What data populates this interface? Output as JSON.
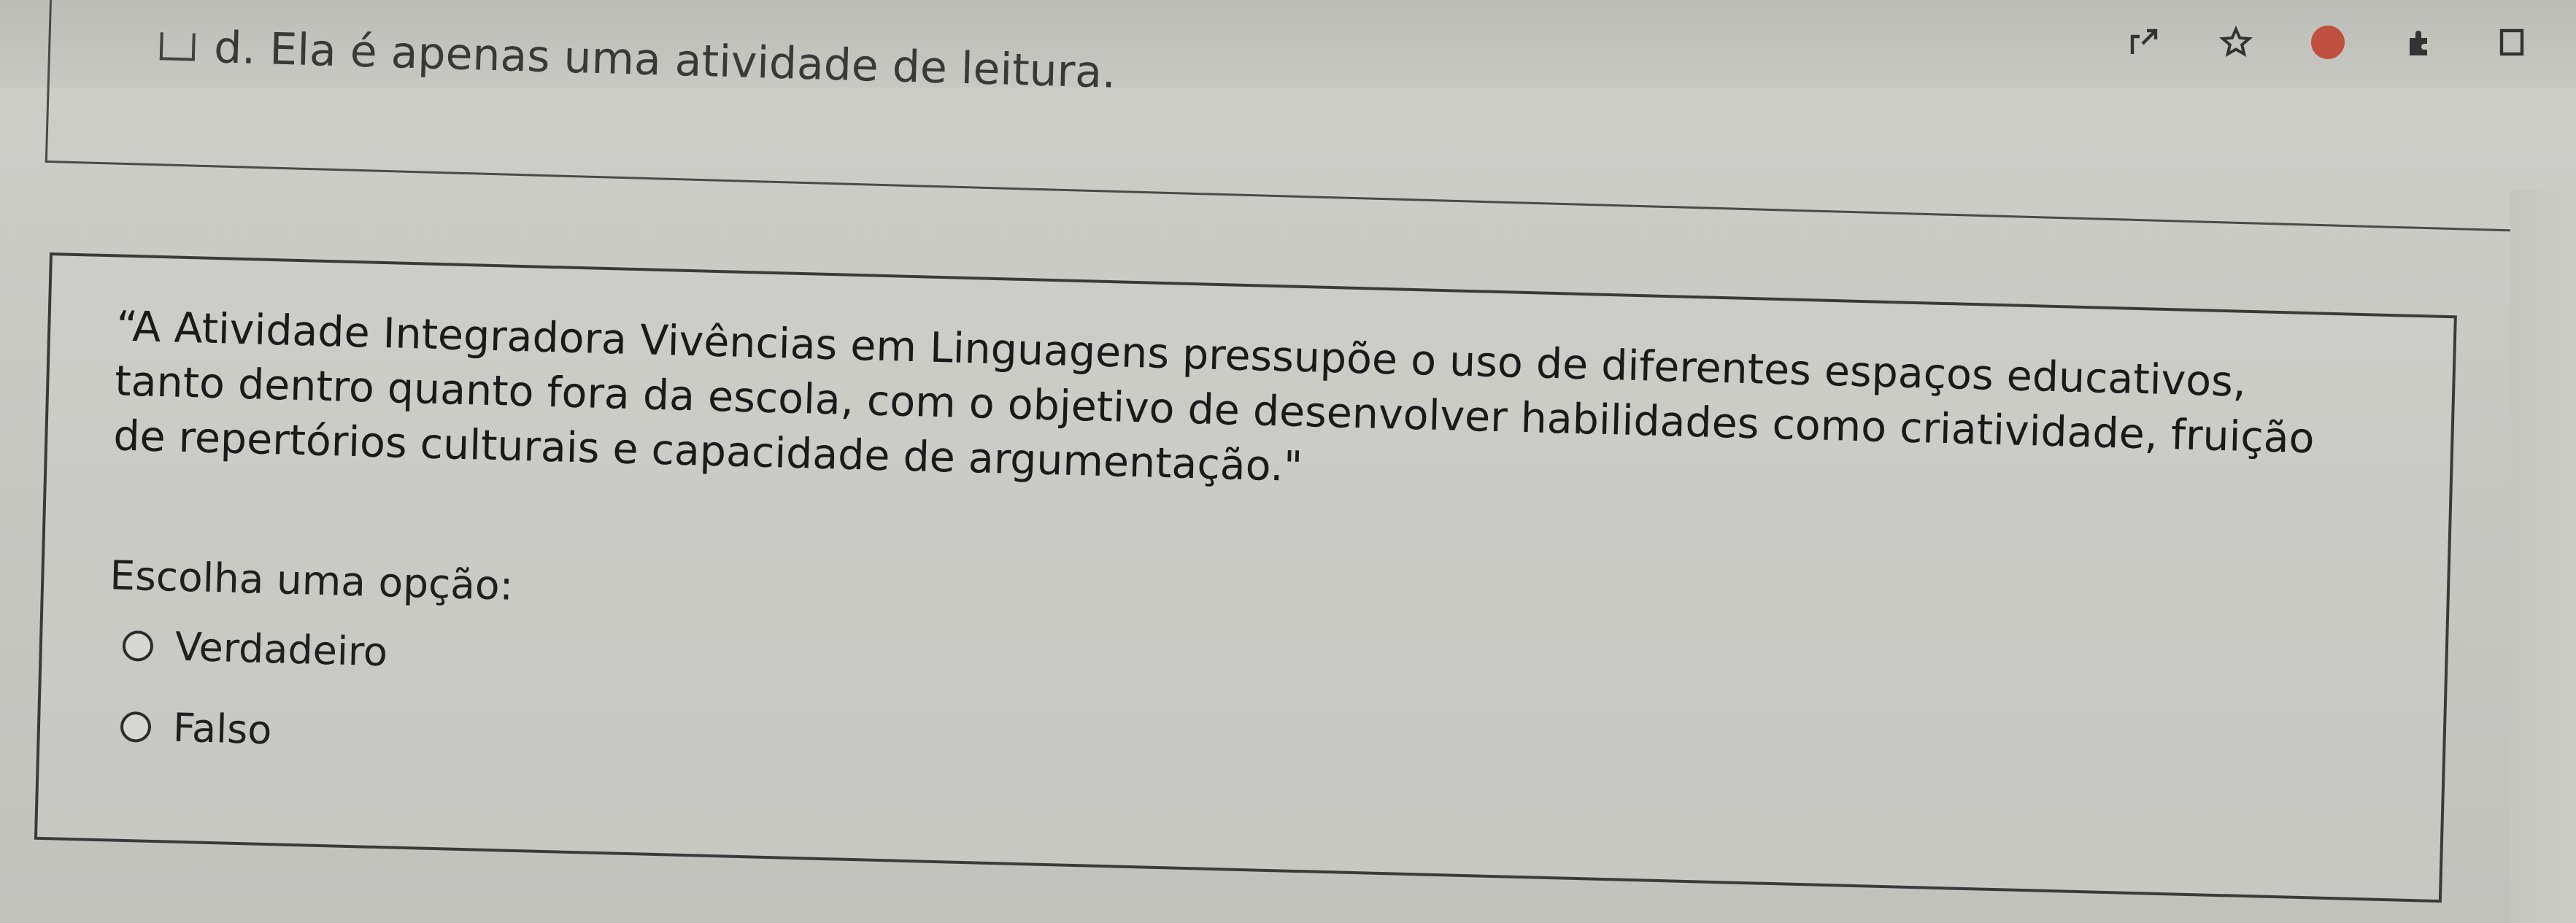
{
  "toolbar": {
    "icons": [
      "share-icon",
      "star-icon",
      "profile-icon",
      "extension-icon",
      "window-icon"
    ],
    "profile_color": "#c0503f"
  },
  "previous_question": {
    "option_text": "d. Ela é apenas uma atividade de leitura."
  },
  "question": {
    "text": "“A Atividade Integradora Vivências em Linguagens pressupõe o uso de diferentes espaços educativos, tanto dentro quanto fora da escola, com o objetivo de desenvolver habilidades como criatividade, fruição de repertórios culturais e capacidade de argumentação.\"",
    "prompt": "Escolha uma opção:",
    "options": [
      {
        "label": "Verdadeiro",
        "selected": false
      },
      {
        "label": "Falso",
        "selected": false
      }
    ]
  }
}
